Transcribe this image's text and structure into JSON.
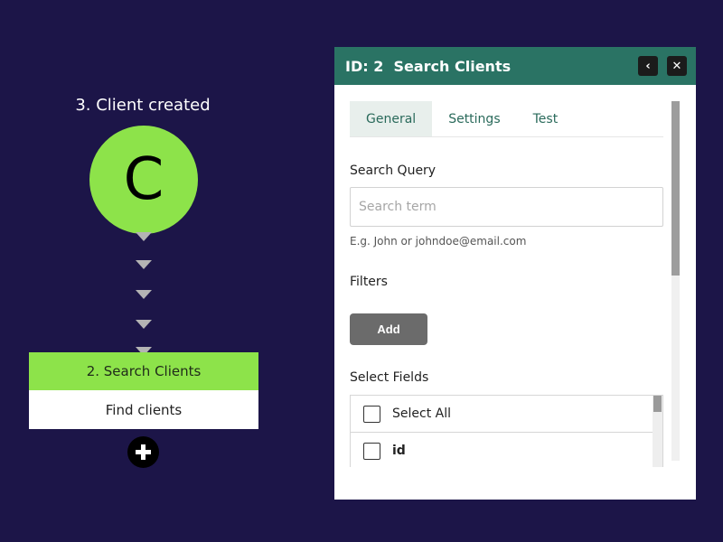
{
  "flow": {
    "trigger": {
      "title": "3. Client created",
      "letter": "C",
      "color": "#8de34a"
    },
    "step": {
      "title": "2. Search Clients",
      "subtitle": "Find clients"
    },
    "add_step_icon": "plus-circle-icon"
  },
  "panel": {
    "title": "ID: 2  Search Clients",
    "header_color": "#2a7364",
    "back_icon": "chevron-left-icon",
    "back_glyph": "‹",
    "close_icon": "close-icon",
    "close_glyph": "✕",
    "tabs": [
      {
        "label": "General",
        "active": true
      },
      {
        "label": "Settings",
        "active": false
      },
      {
        "label": "Test",
        "active": false
      }
    ],
    "search_query": {
      "label": "Search Query",
      "placeholder": "Search term",
      "value": "",
      "hint": "E.g. John or johndoe@email.com"
    },
    "filters": {
      "label": "Filters",
      "add_label": "Add"
    },
    "select_fields": {
      "label": "Select Fields",
      "items": [
        {
          "label": "Select All",
          "checked": false
        },
        {
          "label": "id",
          "checked": false
        }
      ]
    }
  }
}
